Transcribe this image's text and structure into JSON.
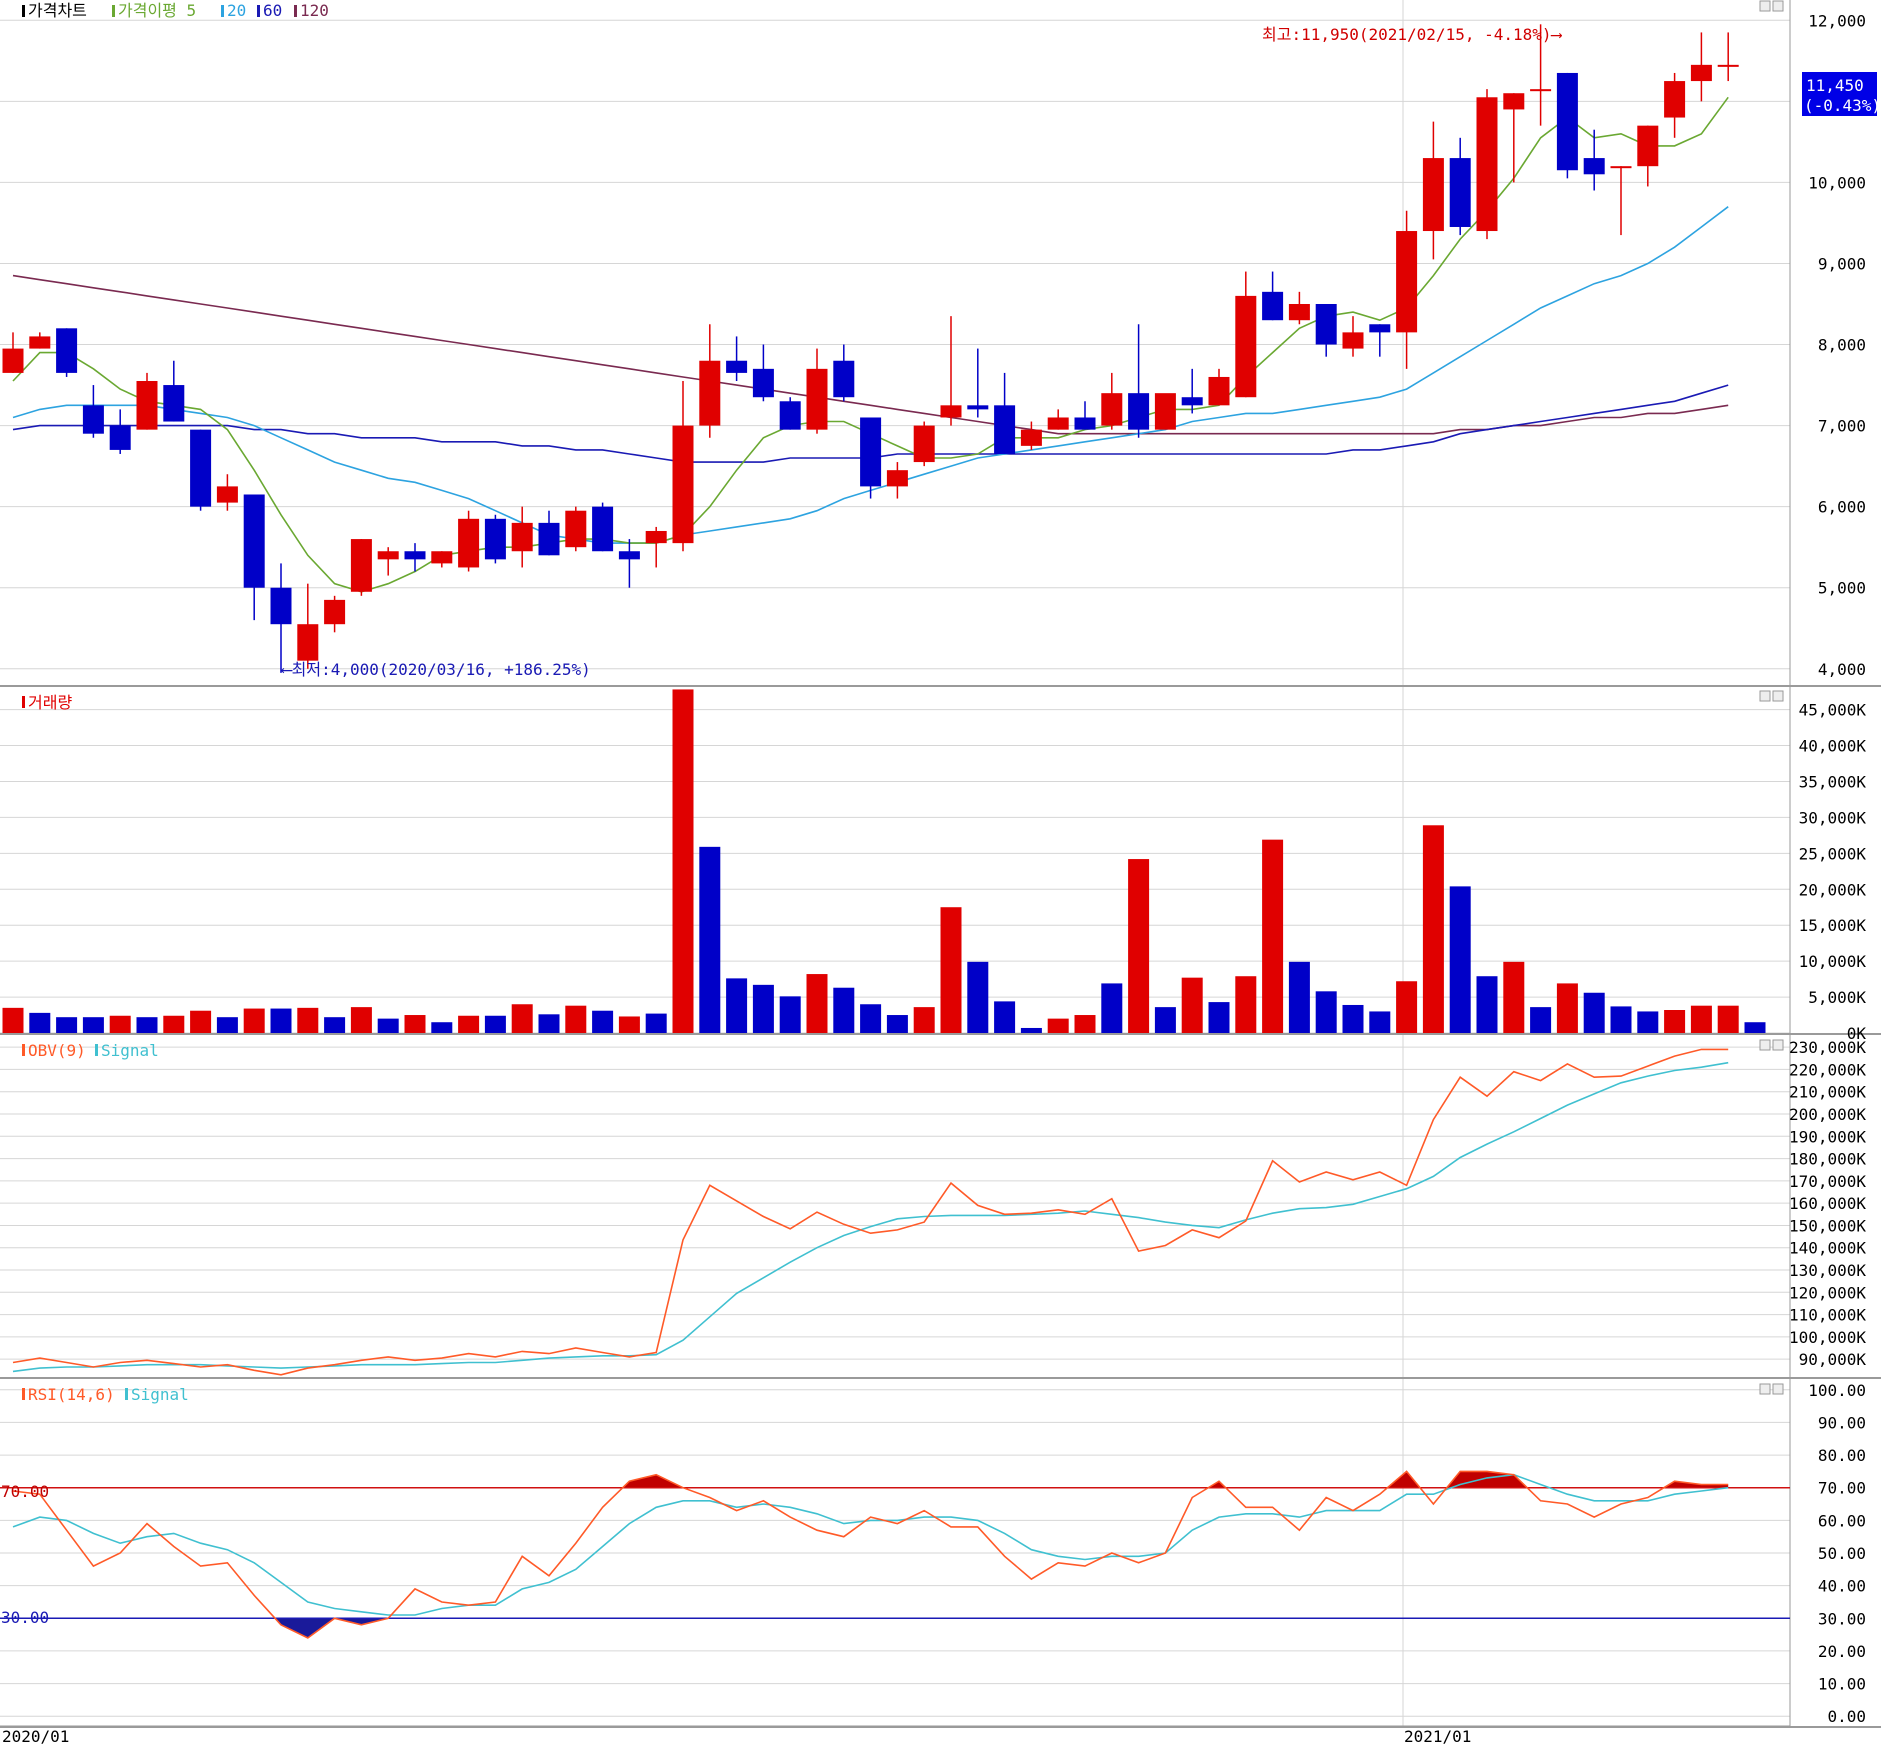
{
  "colors": {
    "up": "#e00000",
    "down": "#0000c8",
    "ma5": "#6aa832",
    "ma20": "#2da3e0",
    "ma60": "#1a1ab4",
    "ma120": "#7a2a50",
    "obv": "#ff5a28",
    "signal": "#40c0d0",
    "rsi_upper": "#d01010",
    "rsi_lower": "#1a1ab4",
    "grid": "#d6d6d6"
  },
  "price_panel": {
    "legend": [
      {
        "text": "가격차트",
        "color": "#000000",
        "icon": "black-marker"
      },
      {
        "text": "가격이평 5",
        "color": "#6aa832",
        "icon": "green-marker"
      },
      {
        "text": "20",
        "color": "#2da3e0",
        "icon": "sky-marker"
      },
      {
        "text": "60",
        "color": "#1a1ab4",
        "icon": "blue-marker"
      },
      {
        "text": "120",
        "color": "#7a2a50",
        "icon": "purple-marker"
      }
    ],
    "high_note": "최고:11,950(2021/02/15, -4.18%)⟶",
    "low_note": "⟵최저:4,000(2020/03/16, +186.25%)",
    "last_price": "11,450",
    "last_change": "(-0.43%)",
    "y_ticks": [
      "4,000",
      "5,000",
      "6,000",
      "7,000",
      "8,000",
      "9,000",
      "10,000",
      "11,000",
      "12,000"
    ]
  },
  "volume_panel": {
    "legend": "거래량",
    "y_ticks": [
      "0K",
      "5,000K",
      "10,000K",
      "15,000K",
      "20,000K",
      "25,000K",
      "30,000K",
      "35,000K",
      "40,000K",
      "45,000K"
    ]
  },
  "obv_panel": {
    "legend_obv": "OBV(9)",
    "legend_signal": "Signal",
    "y_ticks": [
      "90,000K",
      "100,000K",
      "110,000K",
      "120,000K",
      "130,000K",
      "140,000K",
      "150,000K",
      "160,000K",
      "170,000K",
      "180,000K",
      "190,000K",
      "200,000K",
      "210,000K",
      "220,000K",
      "230,000K"
    ]
  },
  "rsi_panel": {
    "legend_rsi": "RSI(14,6)",
    "legend_signal": "Signal",
    "upper_label": "70.00",
    "lower_label": "30.00",
    "y_ticks": [
      "0.00",
      "10.00",
      "20.00",
      "30.00",
      "40.00",
      "50.00",
      "60.00",
      "70.00",
      "80.00",
      "90.00",
      "100.00"
    ]
  },
  "x_axis": {
    "labels": [
      "2020/01",
      "2021/01"
    ]
  },
  "chart_data": [
    {
      "type": "candlestick",
      "title": "가격차트",
      "ylim": [
        3800,
        12250
      ],
      "ohlc": [
        [
          7650,
          8150,
          7650,
          7950
        ],
        [
          7950,
          8150,
          7950,
          8100
        ],
        [
          8200,
          8200,
          7600,
          7650
        ],
        [
          7250,
          7500,
          6850,
          6900
        ],
        [
          7000,
          7200,
          6650,
          6700
        ],
        [
          6950,
          7650,
          6950,
          7550
        ],
        [
          7500,
          7800,
          7050,
          7050
        ],
        [
          6950,
          6950,
          5950,
          6000
        ],
        [
          6050,
          6400,
          5950,
          6250
        ],
        [
          6150,
          6150,
          4600,
          5000
        ],
        [
          5000,
          5300,
          3950,
          4550
        ],
        [
          4100,
          5050,
          4000,
          4550
        ],
        [
          4550,
          4900,
          4450,
          4850
        ],
        [
          4950,
          5600,
          4900,
          5600
        ],
        [
          5350,
          5500,
          5150,
          5450
        ],
        [
          5450,
          5550,
          5200,
          5350
        ],
        [
          5300,
          5450,
          5250,
          5450
        ],
        [
          5250,
          5950,
          5200,
          5850
        ],
        [
          5850,
          5900,
          5300,
          5350
        ],
        [
          5450,
          6000,
          5250,
          5800
        ],
        [
          5800,
          5950,
          5400,
          5400
        ],
        [
          5500,
          6000,
          5450,
          5950
        ],
        [
          6000,
          6050,
          5450,
          5450
        ],
        [
          5450,
          5600,
          5000,
          5350
        ],
        [
          5550,
          5750,
          5250,
          5700
        ],
        [
          5550,
          7550,
          5450,
          7000
        ],
        [
          7000,
          8250,
          6850,
          7800
        ],
        [
          7800,
          8100,
          7550,
          7650
        ],
        [
          7700,
          8000,
          7300,
          7350
        ],
        [
          7300,
          7350,
          6950,
          6950
        ],
        [
          6950,
          7950,
          6900,
          7700
        ],
        [
          7800,
          8000,
          7300,
          7350
        ],
        [
          7100,
          7100,
          6100,
          6250
        ],
        [
          6250,
          6550,
          6100,
          6450
        ],
        [
          6550,
          7050,
          6500,
          7000
        ],
        [
          7100,
          8350,
          7000,
          7250
        ],
        [
          7250,
          7950,
          7100,
          7200
        ],
        [
          7250,
          7650,
          6650,
          6650
        ],
        [
          6750,
          7050,
          6700,
          6950
        ],
        [
          6950,
          7200,
          6950,
          7100
        ],
        [
          7100,
          7300,
          6950,
          6950
        ],
        [
          7000,
          7650,
          6950,
          7400
        ],
        [
          7400,
          8250,
          6850,
          6950
        ],
        [
          6950,
          7300,
          6950,
          7400
        ],
        [
          7350,
          7700,
          7150,
          7250
        ],
        [
          7250,
          7700,
          7250,
          7600
        ],
        [
          7350,
          8900,
          7350,
          8600
        ],
        [
          8650,
          8900,
          8300,
          8300
        ],
        [
          8300,
          8650,
          8250,
          8500
        ],
        [
          8500,
          8500,
          7850,
          8000
        ],
        [
          7950,
          8350,
          7850,
          8150
        ],
        [
          8250,
          8250,
          7850,
          8150
        ],
        [
          8150,
          9650,
          7700,
          9400
        ],
        [
          9400,
          10750,
          9050,
          10300
        ],
        [
          10300,
          10550,
          9350,
          9450
        ],
        [
          9400,
          11150,
          9300,
          11050
        ],
        [
          10900,
          11100,
          10000,
          11100
        ],
        [
          11150,
          11950,
          10700,
          11150
        ],
        [
          11350,
          11350,
          10050,
          10150
        ],
        [
          10300,
          10650,
          9900,
          10100
        ],
        [
          10200,
          10200,
          9350,
          10200
        ],
        [
          10200,
          10700,
          9950,
          10700
        ],
        [
          10800,
          11350,
          10550,
          11250
        ],
        [
          11250,
          11850,
          11000,
          11450
        ],
        [
          11450,
          11850,
          11250,
          11450
        ]
      ],
      "ma5": [
        7550,
        7900,
        7900,
        7700,
        7450,
        7300,
        7250,
        7200,
        6950,
        6450,
        5900,
        5400,
        5050,
        4950,
        5050,
        5200,
        5400,
        5450,
        5500,
        5500,
        5550,
        5600,
        5600,
        5550,
        5550,
        5650,
        6000,
        6450,
        6850,
        7000,
        7050,
        7050,
        6900,
        6750,
        6600,
        6600,
        6650,
        6850,
        6850,
        6850,
        6950,
        7000,
        7100,
        7200,
        7200,
        7250,
        7600,
        7900,
        8200,
        8350,
        8400,
        8300,
        8450,
        8850,
        9300,
        9650,
        10050,
        10550,
        10800,
        10550,
        10600,
        10450,
        10450,
        10600,
        11050
      ],
      "ma20": [
        7100,
        7200,
        7250,
        7250,
        7250,
        7250,
        7200,
        7150,
        7100,
        7000,
        6850,
        6700,
        6550,
        6450,
        6350,
        6300,
        6200,
        6100,
        5950,
        5800,
        5650,
        5600,
        5550,
        5550,
        5550,
        5650,
        5700,
        5750,
        5800,
        5850,
        5950,
        6100,
        6200,
        6300,
        6400,
        6500,
        6600,
        6650,
        6700,
        6750,
        6800,
        6850,
        6900,
        6950,
        7050,
        7100,
        7150,
        7150,
        7200,
        7250,
        7300,
        7350,
        7450,
        7650,
        7850,
        8050,
        8250,
        8450,
        8600,
        8750,
        8850,
        9000,
        9200,
        9450,
        9700
      ],
      "ma60": [
        6950,
        7000,
        7000,
        7000,
        7000,
        7000,
        7000,
        7000,
        7000,
        6950,
        6950,
        6900,
        6900,
        6850,
        6850,
        6850,
        6800,
        6800,
        6800,
        6750,
        6750,
        6700,
        6700,
        6650,
        6600,
        6550,
        6550,
        6550,
        6550,
        6600,
        6600,
        6600,
        6600,
        6650,
        6650,
        6650,
        6650,
        6650,
        6650,
        6650,
        6650,
        6650,
        6650,
        6650,
        6650,
        6650,
        6650,
        6650,
        6650,
        6650,
        6700,
        6700,
        6750,
        6800,
        6900,
        6950,
        7000,
        7050,
        7100,
        7150,
        7200,
        7250,
        7300,
        7400,
        7500
      ],
      "ma120": [
        8850,
        8800,
        8750,
        8700,
        8650,
        8600,
        8550,
        8500,
        8450,
        8400,
        8350,
        8300,
        8250,
        8200,
        8150,
        8100,
        8050,
        8000,
        7950,
        7900,
        7850,
        7800,
        7750,
        7700,
        7650,
        7600,
        7550,
        7500,
        7450,
        7400,
        7350,
        7300,
        7250,
        7200,
        7150,
        7100,
        7050,
        7000,
        6950,
        6900,
        6900,
        6900,
        6900,
        6900,
        6900,
        6900,
        6900,
        6900,
        6900,
        6900,
        6900,
        6900,
        6900,
        6900,
        6950,
        6950,
        7000,
        7000,
        7050,
        7100,
        7100,
        7150,
        7150,
        7200,
        7250
      ]
    },
    {
      "type": "bar",
      "title": "거래량",
      "ylim": [
        0,
        48000
      ],
      "values": [
        3500,
        2800,
        2200,
        2200,
        2400,
        2200,
        2400,
        3100,
        2200,
        3400,
        3400,
        3500,
        2200,
        3600,
        2000,
        2500,
        1500,
        2400,
        2400,
        4000,
        2600,
        3800,
        3100,
        2300,
        2700,
        47800,
        25900,
        7600,
        6700,
        5100,
        8200,
        6300,
        4000,
        2500,
        3600,
        17500,
        9900,
        4400,
        700,
        2000,
        2500,
        6900,
        24200,
        3600,
        7700,
        4300,
        7900,
        26900,
        9900,
        5800,
        3900,
        3000,
        7200,
        28900,
        20400,
        7900,
        9900,
        3600,
        6900,
        5600,
        3700,
        3000,
        3200,
        3800,
        3800,
        1500
      ],
      "up": [
        true,
        false,
        false,
        false,
        true,
        false,
        true,
        true,
        false,
        true,
        false,
        true,
        false,
        true,
        false,
        true,
        false,
        true,
        false,
        true,
        false,
        true,
        false,
        true,
        false,
        true,
        false,
        false,
        false,
        false,
        true,
        false,
        false,
        false,
        true,
        true,
        false,
        false,
        false,
        true,
        true,
        false,
        true,
        false,
        true,
        false,
        true,
        true,
        false,
        false,
        false,
        false,
        true,
        true,
        false,
        false,
        true,
        false,
        true,
        false,
        false,
        false,
        true,
        true,
        true,
        false
      ]
    },
    {
      "type": "line",
      "title": "OBV(9)",
      "ylim": [
        82000,
        235000
      ],
      "series": [
        {
          "name": "OBV(9)",
          "values": [
            88500,
            90500,
            88500,
            86500,
            88500,
            89500,
            88000,
            86500,
            87500,
            85000,
            83000,
            86000,
            87500,
            89500,
            91000,
            89500,
            90500,
            92500,
            91000,
            93500,
            92500,
            95000,
            93000,
            91000,
            93000,
            143500,
            168000,
            161000,
            154000,
            148500,
            156000,
            150500,
            146500,
            148000,
            151500,
            169000,
            159000,
            155000,
            155500,
            157000,
            155000,
            162000,
            138500,
            141000,
            148000,
            144500,
            152000,
            179000,
            169500,
            174000,
            170500,
            174000,
            168000,
            197500,
            216500,
            208000,
            219000,
            215000,
            222500,
            216500,
            217000,
            221500,
            226000,
            229000,
            229000
          ]
        },
        {
          "name": "Signal",
          "values": [
            84500,
            86000,
            86500,
            86500,
            87000,
            87500,
            87500,
            87500,
            87000,
            86500,
            86000,
            86500,
            87000,
            87500,
            87500,
            87500,
            88000,
            88500,
            88500,
            89500,
            90500,
            91000,
            91500,
            91500,
            92000,
            98500,
            109000,
            119500,
            126500,
            133500,
            140000,
            145500,
            149500,
            153000,
            154000,
            154500,
            154500,
            154500,
            155000,
            155500,
            156500,
            155000,
            153500,
            151500,
            150000,
            149000,
            152500,
            155500,
            157500,
            158000,
            159500,
            163000,
            166500,
            172000,
            180500,
            186500,
            192000,
            198000,
            204000,
            209000,
            214000,
            217000,
            219500,
            221000,
            223000
          ]
        }
      ]
    },
    {
      "type": "line",
      "title": "RSI(14,6)",
      "ylim": [
        -3,
        103
      ],
      "series": [
        {
          "name": "RSI(14,6)",
          "values": [
            69,
            68,
            57,
            46,
            50,
            59,
            52,
            46,
            47,
            37,
            28,
            24,
            30,
            28,
            30,
            39,
            35,
            34,
            35,
            49,
            43,
            53,
            64,
            72,
            74,
            70,
            67,
            63,
            66,
            61,
            57,
            55,
            61,
            59,
            63,
            58,
            58,
            49,
            42,
            47,
            46,
            50,
            47,
            50,
            67,
            72,
            64,
            64,
            57,
            67,
            63,
            68,
            75,
            65,
            75,
            75,
            74,
            66,
            65,
            61,
            65,
            67,
            72,
            71,
            71
          ]
        },
        {
          "name": "Signal",
          "values": [
            58,
            61,
            60,
            56,
            53,
            55,
            56,
            53,
            51,
            47,
            41,
            35,
            33,
            32,
            31,
            31,
            33,
            34,
            34,
            39,
            41,
            45,
            52,
            59,
            64,
            66,
            66,
            64,
            65,
            64,
            62,
            59,
            60,
            60,
            61,
            61,
            60,
            56,
            51,
            49,
            48,
            49,
            49,
            50,
            57,
            61,
            62,
            62,
            61,
            63,
            63,
            63,
            68,
            68,
            71,
            73,
            74,
            71,
            68,
            66,
            66,
            66,
            68,
            69,
            70
          ]
        }
      ],
      "reference_lines": [
        70,
        30
      ]
    }
  ]
}
